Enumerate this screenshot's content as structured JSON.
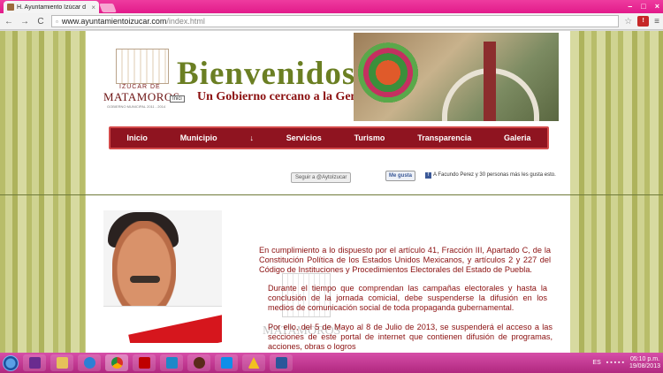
{
  "browser": {
    "tab_title": "H. Ayuntamiento Izúcar d",
    "tab_close": "×",
    "window_buttons": [
      "–",
      "□",
      "×"
    ],
    "url_domain": "www.ayuntamientoizucar.com",
    "url_path": "/index.html",
    "nav_back": "←",
    "nav_forward": "→",
    "nav_reload": "C",
    "star": "☆",
    "menu": "≡"
  },
  "header": {
    "logo_small": "IZUCAR DE",
    "logo_big": "MATAMOROS",
    "logo_sub": "GOBIERNO MUNICIPAL 2011 - 2014",
    "logo_tag": "Inici",
    "welcome": "Bienvenidos",
    "slogan": "Un Gobierno cercano a la Gente..."
  },
  "nav": {
    "items": [
      {
        "label": "Inicio"
      },
      {
        "label": "Municipio"
      },
      {
        "label": "↓"
      },
      {
        "label": "Servicios"
      },
      {
        "label": "Turismo"
      },
      {
        "label": "Transparencia"
      },
      {
        "label": "Galeria"
      }
    ]
  },
  "social": {
    "twitter": "Seguir a @AytoIzucar",
    "like": "Me gusta",
    "fb": "f",
    "like_note": "A Facundo Perez y 30 personas más les gusta esto."
  },
  "content": {
    "p1": "En cumplimiento a lo dispuesto por el artículo 41, Fracción III, Apartado C, de la Constitución Política de los Estados Unidos Mexicanos, y artículos 2 y 227 del Código de Instituciones y Procedimientos Electorales del Estado de Puebla.",
    "p2": "Durante el tiempo que comprendan las campañas electorales y hasta la conclusión de la jornada comicial, debe suspenderse la difusión en los medios de comunicación social de toda propaganda gubernamental.",
    "p3": "Por ello, del 5 de Mayo al 8 de Julio de 2013, se suspenderá el acceso a las secciones de este portal de internet que contienen difusión de programas, acciones, obras o logros",
    "watermark_small": "IZUCAR DE",
    "watermark_big": "MATAMOROS"
  },
  "taskbar": {
    "apps": [
      "windows-media-icon",
      "folder-icon",
      "ie-icon",
      "chrome-icon",
      "filezilla-icon",
      "media-player-icon",
      "photo-icon",
      "teamviewer-icon",
      "warning-icon",
      "word-icon"
    ],
    "lang": "ES",
    "time": "05:10 p.m.",
    "date": "19/08/2013"
  },
  "colors": {
    "accent_pink": "#e21b8a",
    "nav_red": "#8f1420",
    "text_red": "#8b1010",
    "welcome_green": "#6b7f23"
  }
}
